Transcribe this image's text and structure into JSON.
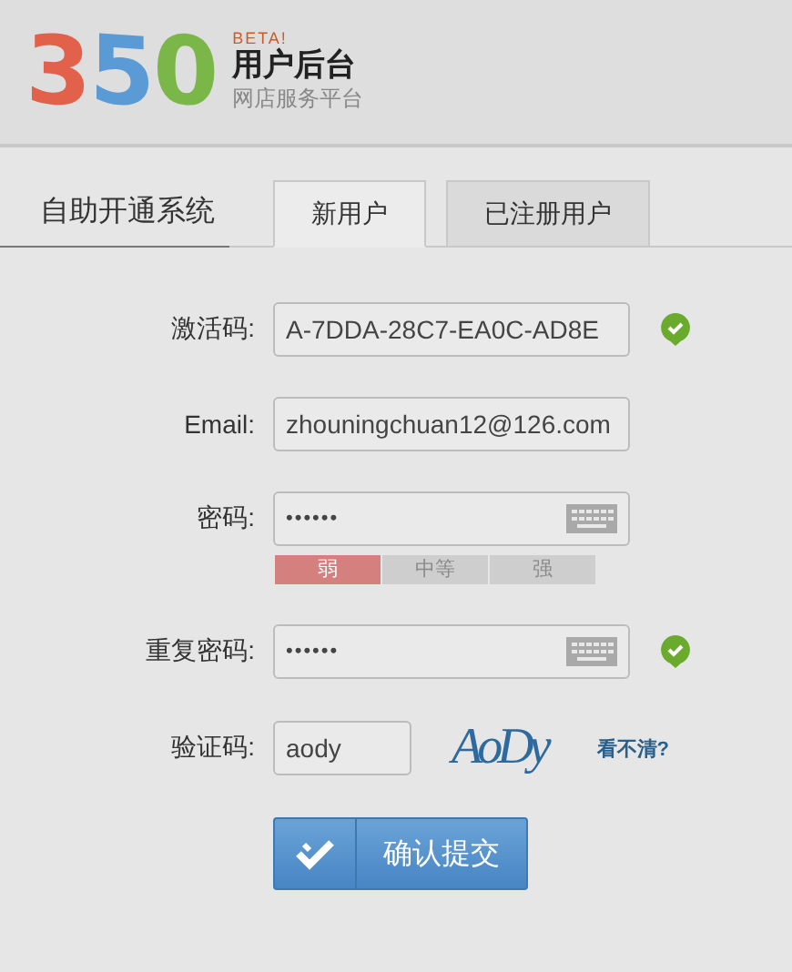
{
  "logo": {
    "digits": [
      {
        "char": "3",
        "color": "#e2614b"
      },
      {
        "char": "5",
        "color": "#5b9bd5"
      },
      {
        "char": "0",
        "color": "#7ab648"
      }
    ],
    "badge": "BETA!",
    "title": "用户后台",
    "subtitle": "网店服务平台"
  },
  "nav": {
    "heading": "自助开通系统",
    "tabs": [
      {
        "label": "新用户",
        "selected": true
      },
      {
        "label": "已注册用户",
        "selected": false
      }
    ]
  },
  "form": {
    "fields": [
      {
        "label": "激活码:",
        "kind": "text",
        "value": "A-7DDA-28C7-EA0C-AD8E",
        "valid": true
      },
      {
        "label": "Email:",
        "kind": "text",
        "value": "zhouningchuan12@126.com",
        "valid": false
      },
      {
        "label": "密码:",
        "kind": "password",
        "value": "••••••",
        "valid": false,
        "strength": [
          {
            "label": "弱",
            "selected": true
          },
          {
            "label": "中等",
            "selected": false
          },
          {
            "label": "强",
            "selected": false
          }
        ]
      },
      {
        "label": "重复密码:",
        "kind": "password",
        "value": "••••••",
        "valid": true
      },
      {
        "label": "验证码:",
        "kind": "captcha",
        "value": "aody",
        "captcha_text": "AoDy",
        "refresh_link": "看不清?",
        "valid": false
      }
    ],
    "submit": "确认提交"
  }
}
